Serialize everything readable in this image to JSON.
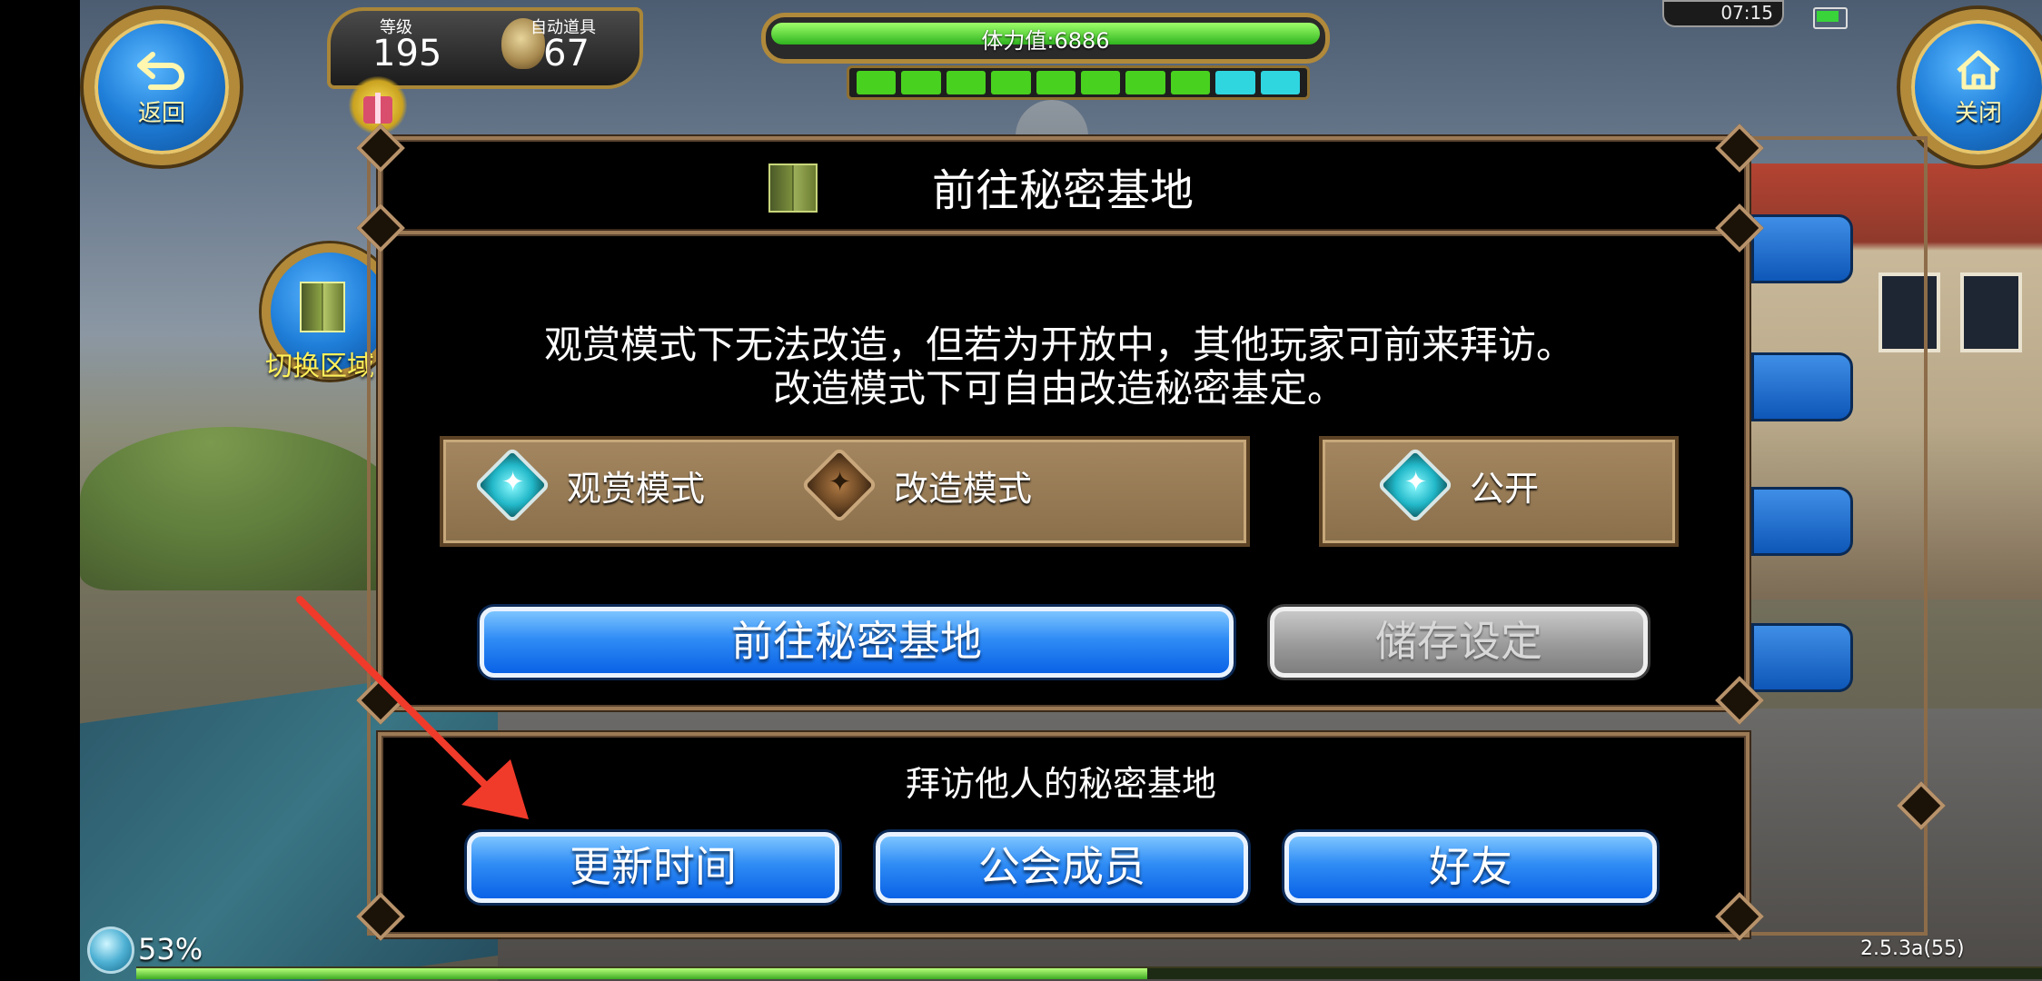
{
  "hud": {
    "back_label": "返回",
    "close_label": "关闭",
    "level_caption": "等级",
    "level_value": "195",
    "auto_items_caption": "自动道具",
    "auto_items_value": "67",
    "stamina_text": "体力值:6886",
    "stamina_fraction": 1.0,
    "stamina_pips": [
      {
        "color": "#49d11f"
      },
      {
        "color": "#49d11f"
      },
      {
        "color": "#49d11f"
      },
      {
        "color": "#49d11f"
      },
      {
        "color": "#49d11f"
      },
      {
        "color": "#49d11f"
      },
      {
        "color": "#49d11f"
      },
      {
        "color": "#49d11f"
      },
      {
        "color": "#2fd6e0"
      },
      {
        "color": "#2fd6e0"
      }
    ],
    "clock": "07:15",
    "battery_fraction": 0.8,
    "switch_area_label": "切换区域",
    "exp_percent": "53%",
    "exp_fraction": 0.53,
    "version": "2.5.3a(55)"
  },
  "dialog": {
    "title": "前往秘密基地",
    "description_line1": "观赏模式下无法改造，但若为开放中，其他玩家可前来拜访。",
    "description_line2": "改造模式下可自由改造秘密基定。",
    "modes": [
      {
        "label": "观赏模式",
        "selected": true
      },
      {
        "label": "改造模式",
        "selected": false
      }
    ],
    "public_option": {
      "label": "公开",
      "selected": true
    },
    "go_button": "前往秘密基地",
    "save_button": "储存设定"
  },
  "visit": {
    "title": "拜访他人的秘密基地",
    "buttons": [
      "更新时间",
      "公会成员",
      "好友"
    ]
  },
  "colors": {
    "button_blue": "#0a62e6",
    "gold_frame": "#b28a3a",
    "arrow_red": "#f03a2a"
  }
}
